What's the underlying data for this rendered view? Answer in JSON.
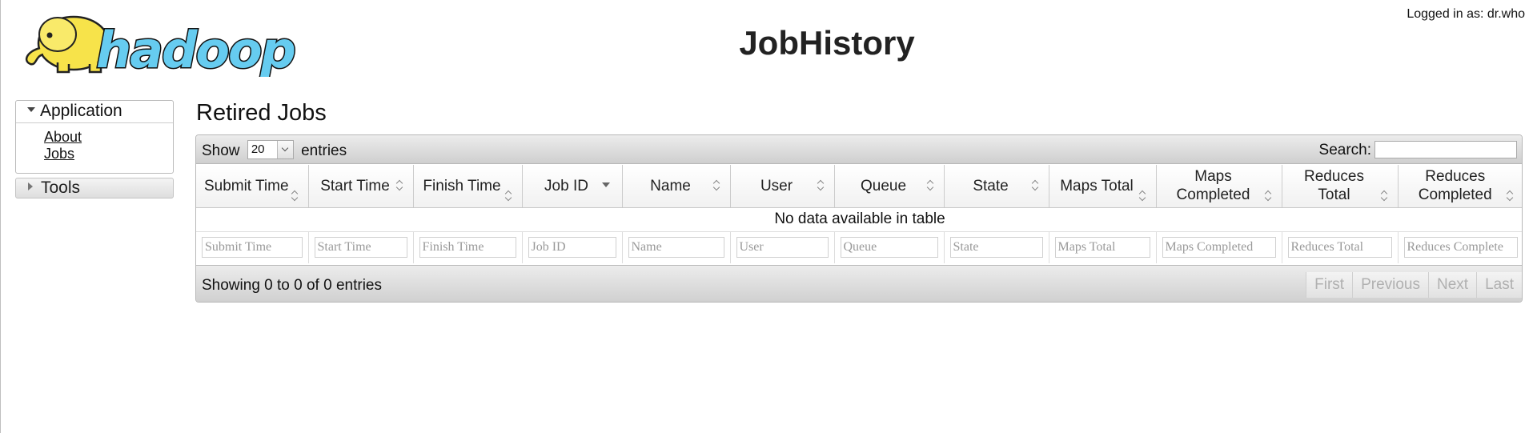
{
  "header": {
    "logo_text": "hadoop",
    "title": "JobHistory",
    "user_info": "Logged in as: dr.who"
  },
  "sidebar": {
    "application": {
      "label": "Application",
      "links": [
        "About",
        "Jobs"
      ]
    },
    "tools": {
      "label": "Tools"
    }
  },
  "main": {
    "section_title": "Retired Jobs",
    "length": {
      "prefix": "Show",
      "value": "20",
      "suffix": "entries"
    },
    "search_label": "Search:",
    "columns": [
      "Submit Time",
      "Start Time",
      "Finish Time",
      "Job ID",
      "Name",
      "User",
      "Queue",
      "State",
      "Maps Total",
      "Maps Completed",
      "Reduces Total",
      "Reduces Completed"
    ],
    "filter_placeholders": [
      "Submit Time",
      "Start Time",
      "Finish Time",
      "Job ID",
      "Name",
      "User",
      "Queue",
      "State",
      "Maps Total",
      "Maps Completed",
      "Reduces Total",
      "Reduces Complete"
    ],
    "empty_message": "No data available in table",
    "info": "Showing 0 to 0 of 0 entries",
    "pagination": [
      "First",
      "Previous",
      "Next",
      "Last"
    ]
  },
  "colors": {
    "logo_elephant": "#f7e34a",
    "logo_text": "#66ccf0"
  }
}
